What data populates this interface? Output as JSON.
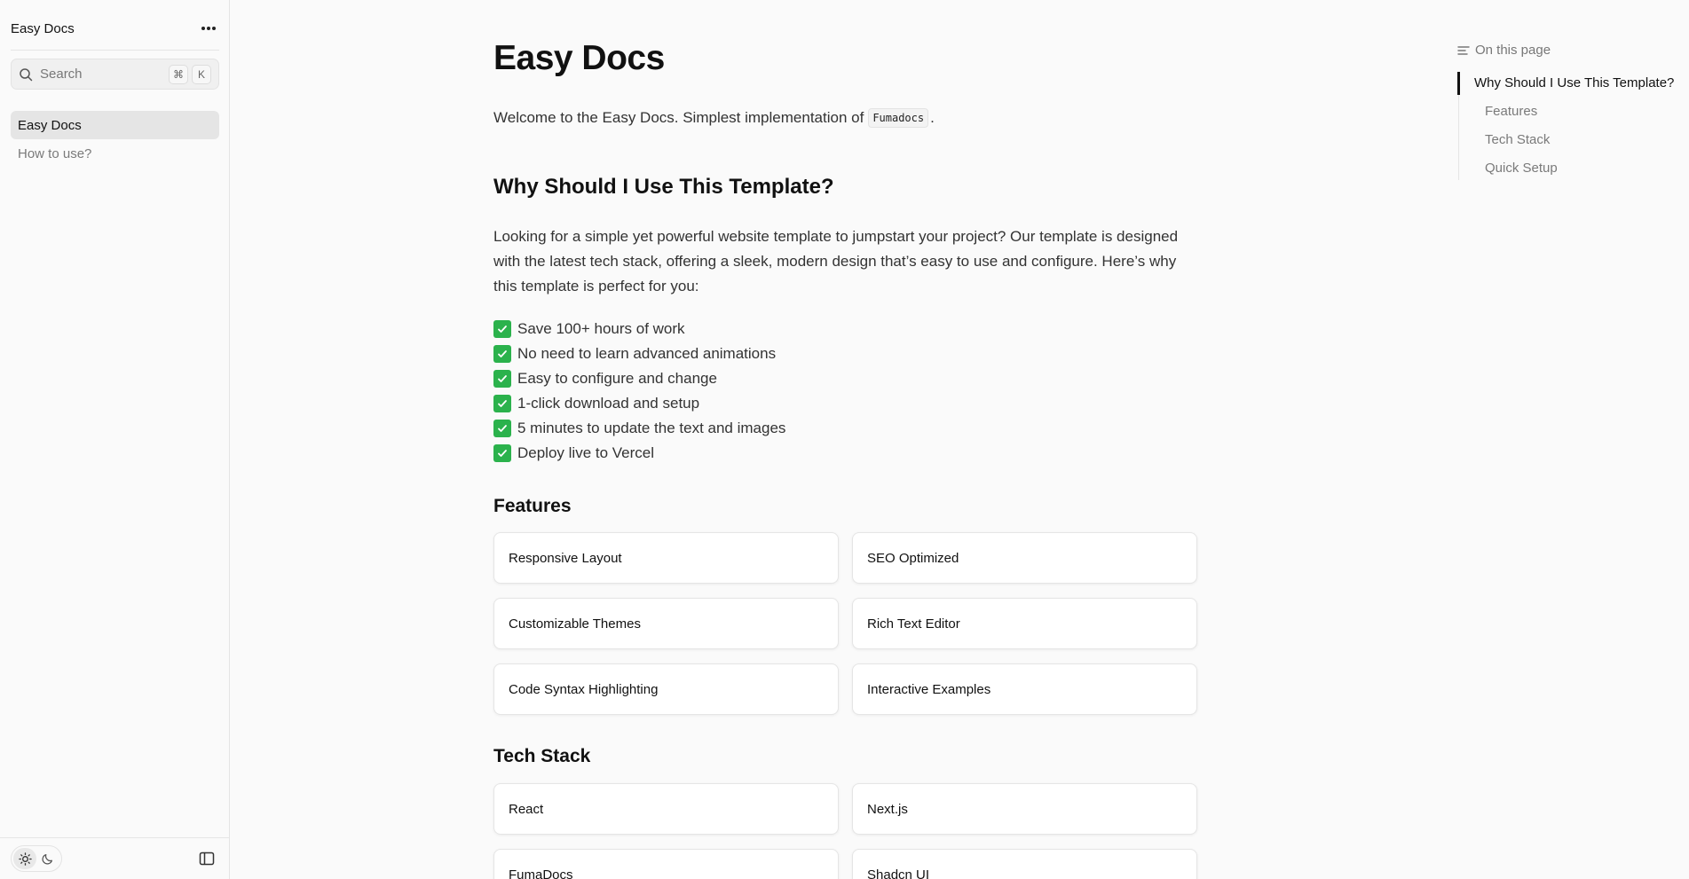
{
  "sidebar": {
    "title": "Easy Docs",
    "search": {
      "placeholder": "Search",
      "shortcut_mod": "⌘",
      "shortcut_key": "K"
    },
    "items": [
      {
        "label": "Easy Docs",
        "active": true
      },
      {
        "label": "How to use?",
        "active": false
      }
    ],
    "footer": {
      "theme_light_icon": "sun-icon",
      "theme_dark_icon": "moon-icon",
      "panel_icon": "sidebar-toggle-icon"
    }
  },
  "main": {
    "title": "Easy Docs",
    "intro_before": "Welcome to the Easy Docs. Simplest implementation of",
    "intro_code": "Fumadocs",
    "intro_after": ".",
    "why_heading": "Why Should I Use This Template?",
    "why_paragraph": "Looking for a simple yet powerful website template to jumpstart your project? Our template is designed with the latest tech stack, offering a sleek, modern design that’s easy to use and configure. Here’s why this template is perfect for you:",
    "checklist": [
      "Save 100+ hours of work",
      "No need to learn advanced animations",
      "Easy to configure and change",
      "1-click download and setup",
      "5 minutes to update the text and images",
      "Deploy live to Vercel"
    ],
    "features_heading": "Features",
    "features": [
      "Responsive Layout",
      "SEO Optimized",
      "Customizable Themes",
      "Rich Text Editor",
      "Code Syntax Highlighting",
      "Interactive Examples"
    ],
    "tech_heading": "Tech Stack",
    "tech": [
      "React",
      "Next.js",
      "FumaDocs",
      "Shadcn UI"
    ]
  },
  "toc": {
    "heading": "On this page",
    "items": [
      {
        "label": "Why Should I Use This Template?",
        "active": true
      },
      {
        "label": "Features",
        "active": false
      },
      {
        "label": "Tech Stack",
        "active": false
      },
      {
        "label": "Quick Setup",
        "active": false
      }
    ]
  },
  "colors": {
    "check_green": "#2bb24c",
    "background": "#fafafa",
    "active_nav": "#e5e5e5"
  }
}
